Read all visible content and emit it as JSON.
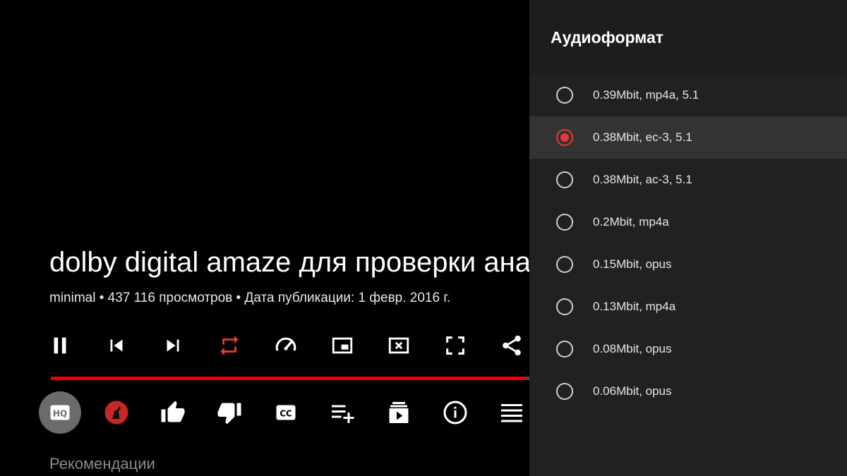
{
  "video": {
    "title": "dolby digital amaze для проверки аналоговых и цифровых",
    "meta": "minimal • 437 116 просмотров • Дата публикации: 1 февр. 2016 г.",
    "progress_fraction": 0.96
  },
  "controls": [
    {
      "name": "pause-button",
      "icon": "pause-icon"
    },
    {
      "name": "previous-button",
      "icon": "skip-previous-icon"
    },
    {
      "name": "next-button",
      "icon": "skip-next-icon"
    },
    {
      "name": "repeat-button",
      "icon": "repeat-icon",
      "color": "#e53935"
    },
    {
      "name": "playback-speed-button",
      "icon": "speedometer-icon"
    },
    {
      "name": "picture-in-picture-button",
      "icon": "pip-icon"
    },
    {
      "name": "close-video-button",
      "icon": "close-box-icon"
    },
    {
      "name": "fullscreen-button",
      "icon": "fullscreen-icon"
    },
    {
      "name": "share-button",
      "icon": "share-icon"
    }
  ],
  "actions": [
    {
      "name": "quality-button",
      "icon": "hq-icon",
      "focused": true
    },
    {
      "name": "channel-avatar-button",
      "icon": "channel-avatar-icon"
    },
    {
      "name": "like-button",
      "icon": "thumb-up-icon"
    },
    {
      "name": "dislike-button",
      "icon": "thumb-down-icon"
    },
    {
      "name": "subtitles-button",
      "icon": "closed-captions-icon"
    },
    {
      "name": "add-to-playlist-button",
      "icon": "playlist-add-icon"
    },
    {
      "name": "subscriptions-button",
      "icon": "subscriptions-icon"
    },
    {
      "name": "video-info-button",
      "icon": "info-icon"
    },
    {
      "name": "more-button",
      "icon": "menu-lines-icon"
    }
  ],
  "recommendations_label": "Рекомендации",
  "audio_panel": {
    "title": "Аудиоформат",
    "options": [
      {
        "label": "0.39Mbit, mp4a, 5.1",
        "selected": false
      },
      {
        "label": "0.38Mbit, ec-3, 5.1",
        "selected": true
      },
      {
        "label": "0.38Mbit, ac-3, 5.1",
        "selected": false
      },
      {
        "label": "0.2Mbit, mp4a",
        "selected": false
      },
      {
        "label": "0.15Mbit, opus",
        "selected": false
      },
      {
        "label": "0.13Mbit, mp4a",
        "selected": false
      },
      {
        "label": "0.08Mbit, opus",
        "selected": false
      },
      {
        "label": "0.06Mbit, opus",
        "selected": false
      }
    ]
  },
  "colors": {
    "accent": "#e53935",
    "progress": "#ee0000",
    "panel_bg": "#212121",
    "selected_row_bg": "#333333"
  }
}
